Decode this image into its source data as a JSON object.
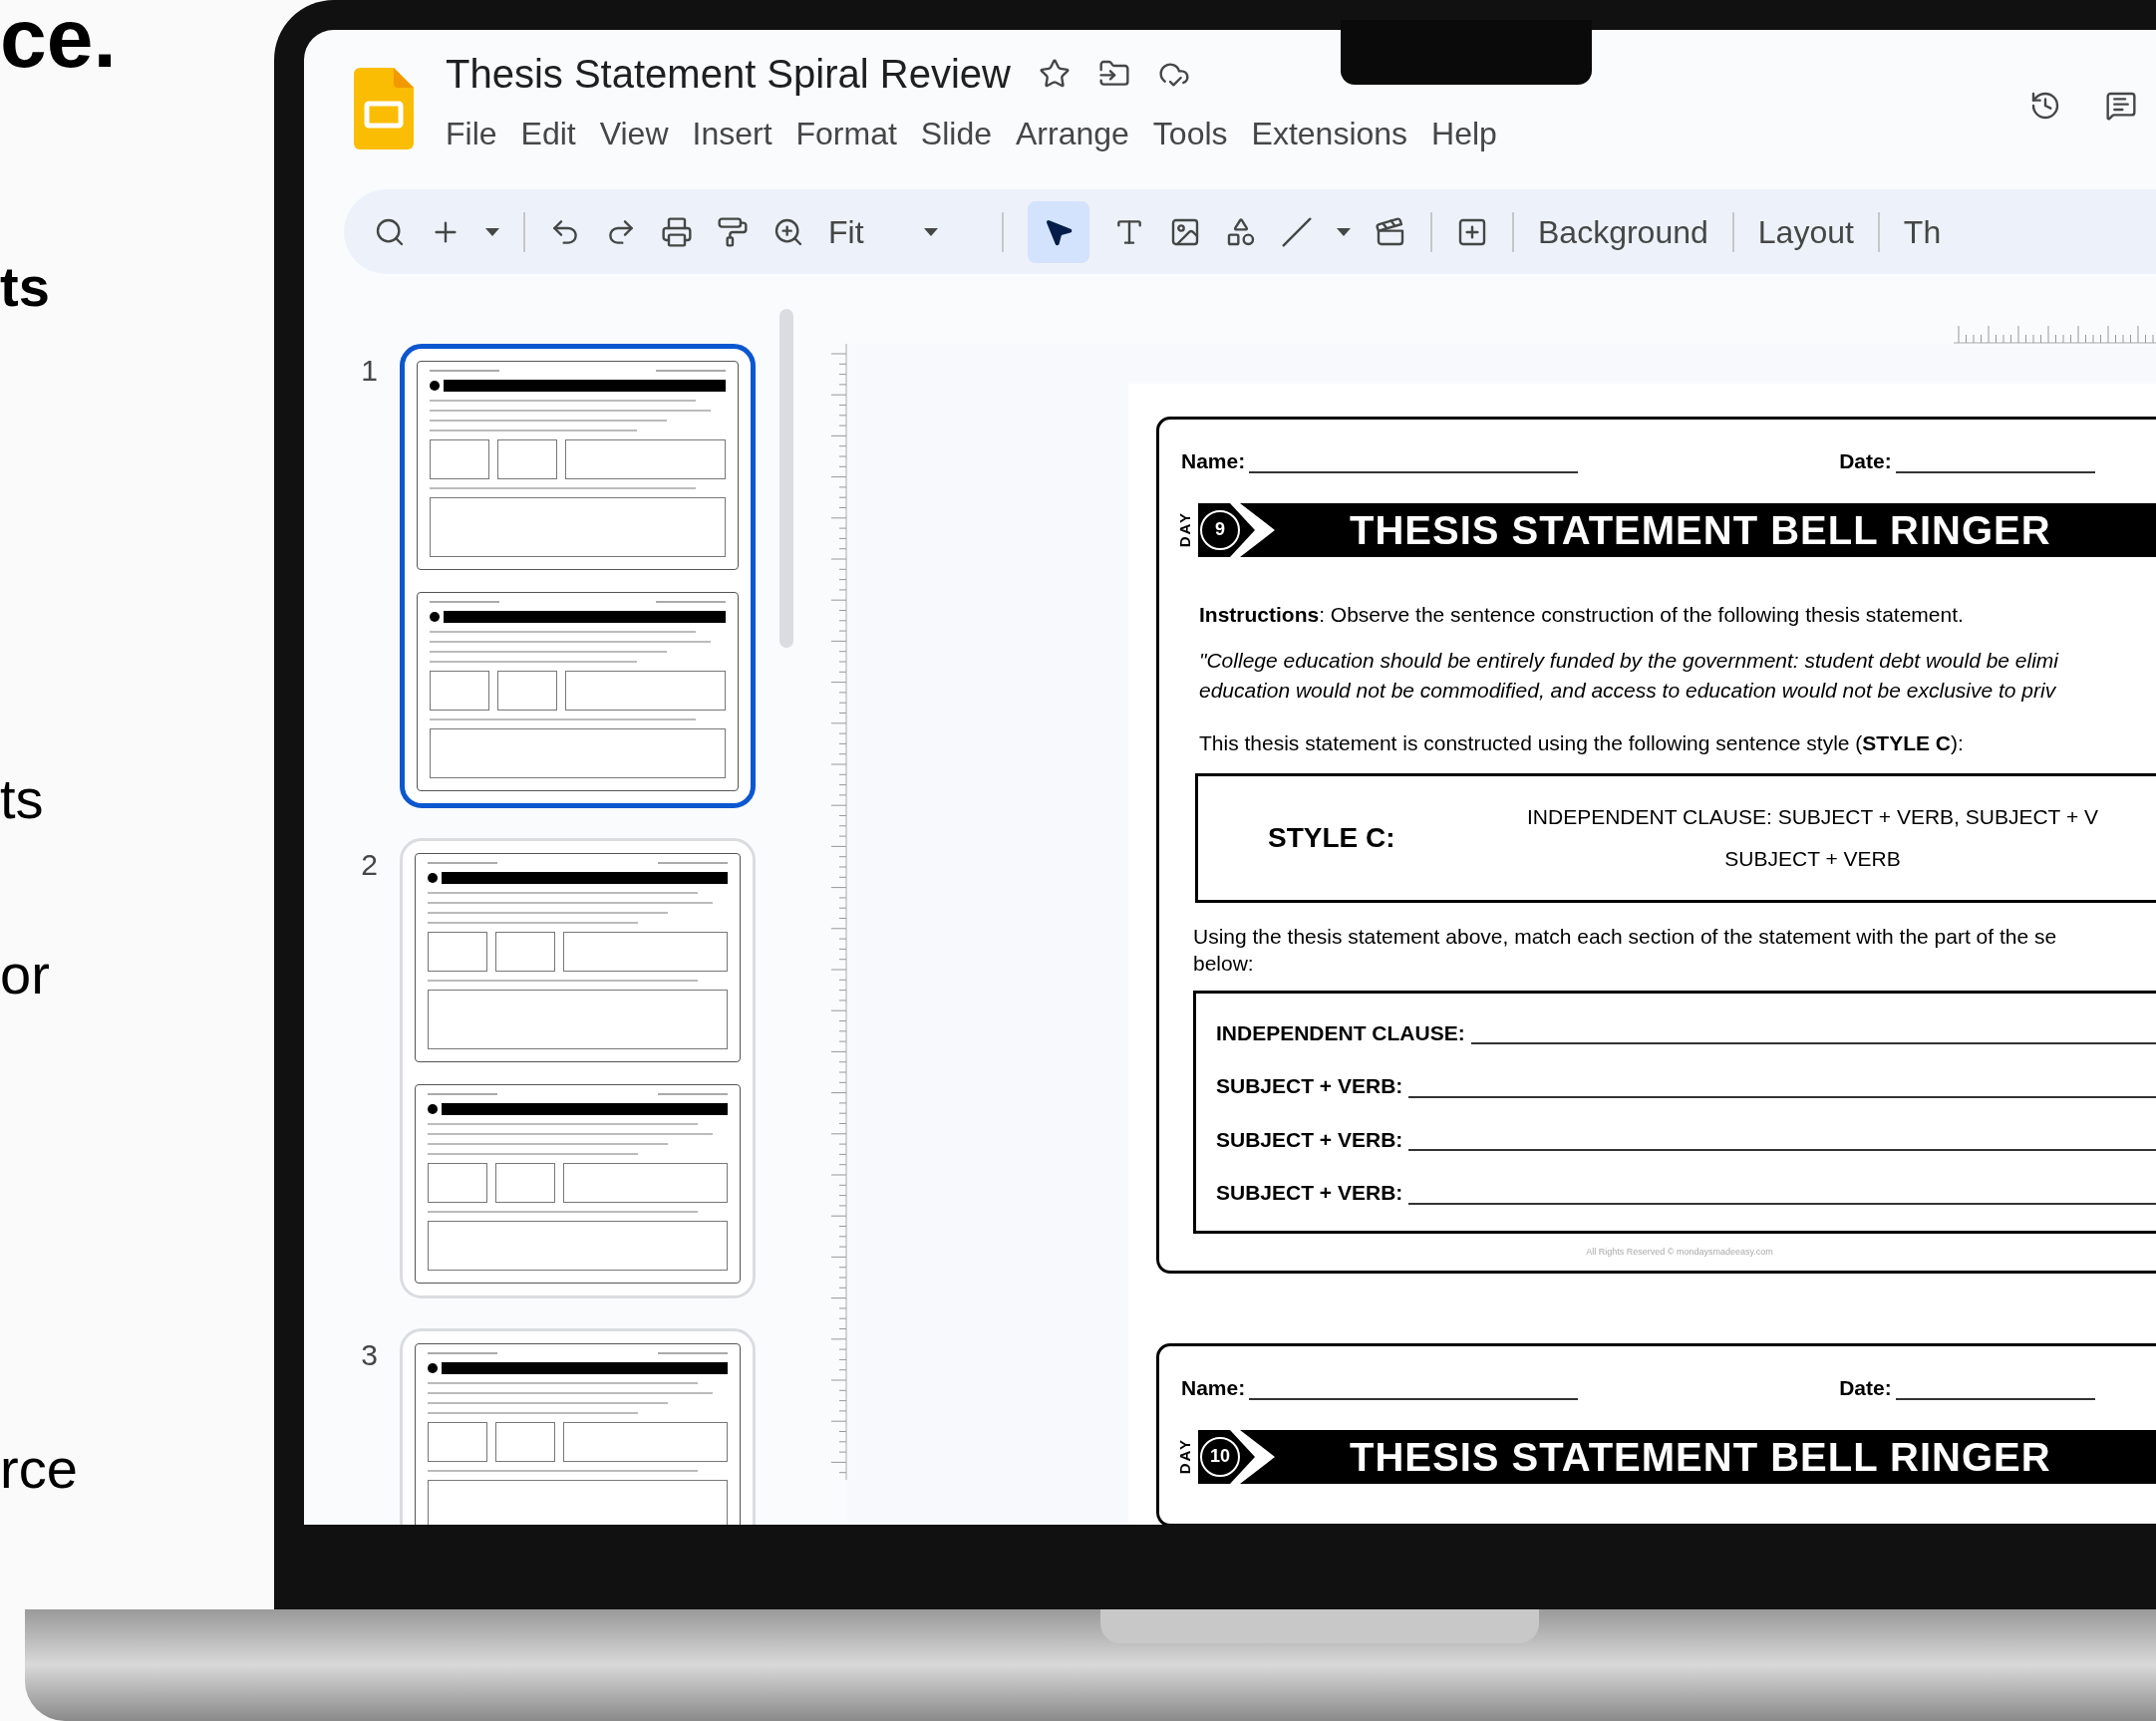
{
  "promo_text": [
    {
      "text": "ce.",
      "kind": "heading"
    },
    {
      "text": "ts",
      "kind": "bold"
    },
    {
      "text": "ts",
      "kind": "plain"
    },
    {
      "text": "or",
      "kind": "plain"
    },
    {
      "text": "rce",
      "kind": "plain"
    }
  ],
  "window": {
    "title": "Thesis Statement Spiral Review"
  },
  "menu": [
    "File",
    "Edit",
    "View",
    "Insert",
    "Format",
    "Slide",
    "Arrange",
    "Tools",
    "Extensions",
    "Help"
  ],
  "toolbar": {
    "zoom": "Fit",
    "pointer_tool": {
      "selected": true
    },
    "buttons": [
      "Background",
      "Layout",
      "Th"
    ]
  },
  "slides_panel": [
    {
      "number": "1",
      "selected": true
    },
    {
      "number": "2",
      "selected": false
    },
    {
      "number": "3",
      "selected": false
    }
  ],
  "worksheets": [
    {
      "name_label": "Name:",
      "date_label": "Date:",
      "day_label": "DAY",
      "day_number": "9",
      "title": "THESIS STATEMENT BELL RINGER",
      "instructions": "**Instructions**: Observe the sentence construction of the following thesis statement.",
      "quote_lines": [
        "\"College education should be entirely funded by the government: student debt would be elimi",
        "education would not be commodified, and access to education would not be exclusive to priv"
      ],
      "style_intro": "This thesis statement is constructed using the following sentence style (**STYLE C**):",
      "style_label": "STYLE C:",
      "style_lines": [
        "INDEPENDENT CLAUSE: SUBJECT + VERB, SUBJECT + V",
        "SUBJECT + VERB"
      ],
      "match_lines": [
        "Using the thesis statement above, match each section of the statement with the part of the se",
        "below:"
      ],
      "answer_rows": [
        "INDEPENDENT CLAUSE:",
        "SUBJECT + VERB:",
        "SUBJECT + VERB:",
        "SUBJECT + VERB:"
      ],
      "footer": "All Rights Reserved © mondaysmadeeasy.com"
    },
    {
      "name_label": "Name:",
      "date_label": "Date:",
      "day_label": "DAY",
      "day_number": "10",
      "title": "THESIS STATEMENT BELL RINGER"
    }
  ]
}
